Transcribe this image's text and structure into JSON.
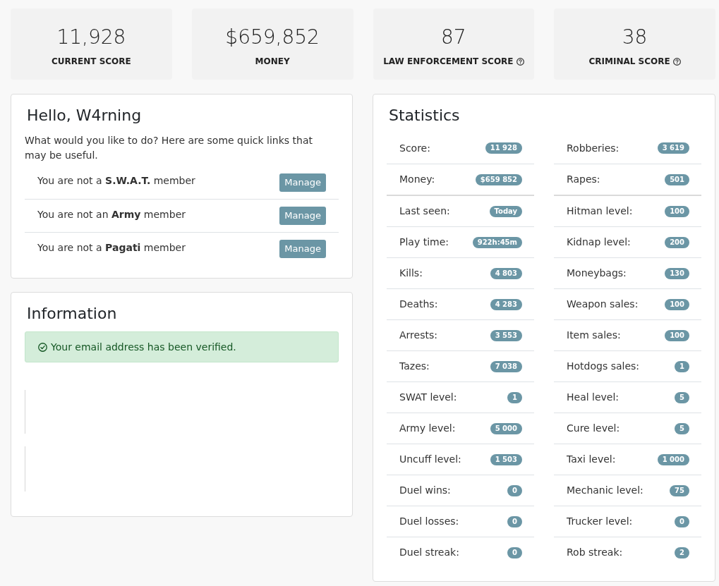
{
  "stat_cards": [
    {
      "value": "11,928",
      "label": "CURRENT SCORE",
      "help": false
    },
    {
      "value": "$659,852",
      "label": "MONEY",
      "help": false
    },
    {
      "value": "87",
      "label": "LAW ENFORCEMENT SCORE",
      "help": true
    },
    {
      "value": "38",
      "label": "CRIMINAL SCORE",
      "help": true
    }
  ],
  "welcome_panel": {
    "title": "Hello, W4rning",
    "intro": "What would you like to do? Here are some quick links that may be useful.",
    "memberships": [
      {
        "text": "You are not a **S.W.A.T.** member",
        "button": "Manage"
      },
      {
        "text": "You are not an **Army** member",
        "button": "Manage"
      },
      {
        "text": "You are not a **Pagati** member",
        "button": "Manage"
      }
    ]
  },
  "information_panel": {
    "title": "Information",
    "alert": {
      "text": "Your email address has been verified."
    }
  },
  "statistics": {
    "title": "Statistics",
    "columns": [
      {
        "groups": [
          [
            {
              "label": "Score:",
              "value": "11 928"
            },
            {
              "label": "Money:",
              "value": "$659 852"
            }
          ],
          [
            {
              "label": "Last seen:",
              "value": "Today"
            },
            {
              "label": "Play time:",
              "value": "922h:45m"
            },
            {
              "label": "Kills:",
              "value": "4 803"
            },
            {
              "label": "Deaths:",
              "value": "4 283"
            },
            {
              "label": "Arrests:",
              "value": "3 553"
            },
            {
              "label": "Tazes:",
              "value": "7 038"
            },
            {
              "label": "SWAT level:",
              "value": "1"
            },
            {
              "label": "Army level:",
              "value": "5 000"
            },
            {
              "label": "Uncuff level:",
              "value": "1 503"
            },
            {
              "label": "Duel wins:",
              "value": "0"
            },
            {
              "label": "Duel losses:",
              "value": "0"
            },
            {
              "label": "Duel streak:",
              "value": "0"
            }
          ]
        ]
      },
      {
        "groups": [
          [
            {
              "label": "Robberies:",
              "value": "3 619"
            },
            {
              "label": "Rapes:",
              "value": "501"
            }
          ],
          [
            {
              "label": "Hitman level:",
              "value": "100"
            },
            {
              "label": "Kidnap level:",
              "value": "200"
            },
            {
              "label": "Moneybags:",
              "value": "130"
            },
            {
              "label": "Weapon sales:",
              "value": "100"
            },
            {
              "label": "Item sales:",
              "value": "100"
            },
            {
              "label": "Hotdogs sales:",
              "value": "1"
            },
            {
              "label": "Heal level:",
              "value": "5"
            },
            {
              "label": "Cure level:",
              "value": "5"
            },
            {
              "label": "Taxi level:",
              "value": "1 000"
            },
            {
              "label": "Mechanic level:",
              "value": "75"
            },
            {
              "label": "Trucker level:",
              "value": "0"
            },
            {
              "label": "Rob streak:",
              "value": "2"
            }
          ]
        ]
      }
    ]
  }
}
